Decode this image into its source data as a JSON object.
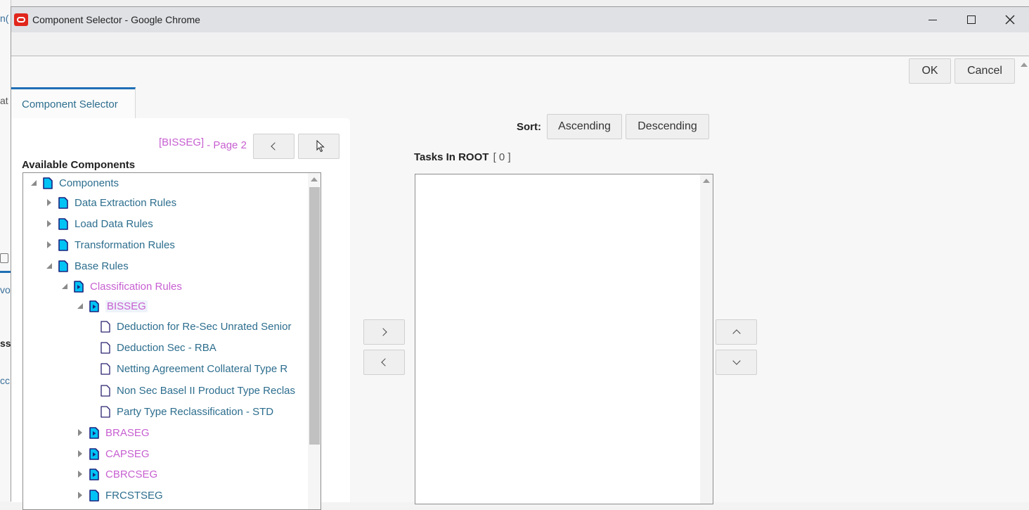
{
  "background_app": {
    "fragments": [
      "n(",
      "at",
      "vo",
      "ss",
      "cc"
    ]
  },
  "window": {
    "title": "Component Selector - Google Chrome",
    "app_icon": "oracle-icon",
    "controls": {
      "minimize": "minimize-icon",
      "maximize": "maximize-icon",
      "close": "close-icon"
    }
  },
  "toolbar": {
    "ok_label": "OK",
    "cancel_label": "Cancel"
  },
  "tab": {
    "label": "Component Selector"
  },
  "left_panel": {
    "page_info": {
      "filter": "[BISSEG]",
      "page": "- Page 2"
    },
    "prev_icon": "chevron-left-icon",
    "next_icon": "chevron-right-icon",
    "heading": "Available Components",
    "tree": [
      {
        "label": "Components",
        "level": 0,
        "state": "expanded",
        "icon": "folder-icon",
        "color": "blue"
      },
      {
        "label": "Data Extraction Rules",
        "level": 1,
        "state": "collapsed",
        "icon": "folder-icon",
        "color": "blue"
      },
      {
        "label": "Load Data Rules",
        "level": 1,
        "state": "collapsed",
        "icon": "folder-icon",
        "color": "blue"
      },
      {
        "label": "Transformation Rules",
        "level": 1,
        "state": "collapsed",
        "icon": "folder-icon",
        "color": "blue"
      },
      {
        "label": "Base Rules",
        "level": 1,
        "state": "expanded",
        "icon": "folder-icon",
        "color": "blue"
      },
      {
        "label": "Classification Rules",
        "level": 2,
        "state": "expanded",
        "icon": "folder-play-icon",
        "color": "pink"
      },
      {
        "label": "BISSEG",
        "level": 3,
        "state": "expanded",
        "icon": "folder-play-icon",
        "color": "pink",
        "selected": true
      },
      {
        "label": "Deduction for Re-Sec Unrated Senior",
        "level": 4,
        "state": "none",
        "icon": "file-icon",
        "color": "blue"
      },
      {
        "label": "Deduction Sec - RBA",
        "level": 4,
        "state": "none",
        "icon": "file-icon",
        "color": "blue"
      },
      {
        "label": "Netting Agreement Collateral Type R",
        "level": 4,
        "state": "none",
        "icon": "file-icon",
        "color": "blue"
      },
      {
        "label": "Non Sec Basel II Product Type Reclas",
        "level": 4,
        "state": "none",
        "icon": "file-icon",
        "color": "blue"
      },
      {
        "label": "Party Type Reclassification - STD",
        "level": 4,
        "state": "none",
        "icon": "file-icon",
        "color": "blue"
      },
      {
        "label": "BRASEG",
        "level": 3,
        "state": "collapsed",
        "icon": "folder-play-icon",
        "color": "pink"
      },
      {
        "label": "CAPSEG",
        "level": 3,
        "state": "collapsed",
        "icon": "folder-play-icon",
        "color": "pink"
      },
      {
        "label": "CBRCSEG",
        "level": 3,
        "state": "collapsed",
        "icon": "folder-play-icon",
        "color": "pink"
      },
      {
        "label": "FRCSTSEG",
        "level": 3,
        "state": "collapsed",
        "icon": "folder-icon",
        "color": "blue"
      }
    ]
  },
  "transfer": {
    "add_icon": "chevron-right-icon",
    "remove_icon": "chevron-left-icon",
    "move_up_icon": "chevron-up-icon",
    "move_down_icon": "chevron-down-icon"
  },
  "right_panel": {
    "sort_label": "Sort:",
    "ascending_label": "Ascending",
    "descending_label": "Descending",
    "tasks_heading": "Tasks In ROOT",
    "tasks_count": "[ 0 ]",
    "tasks": []
  },
  "colors": {
    "accent": "#1f6fb5",
    "link_blue": "#2d6e8e",
    "highlight_pink": "#c75fd1",
    "folder_fill": "#00c3f5",
    "folder_stroke": "#1a237e",
    "oracle_red": "#e1261c"
  }
}
